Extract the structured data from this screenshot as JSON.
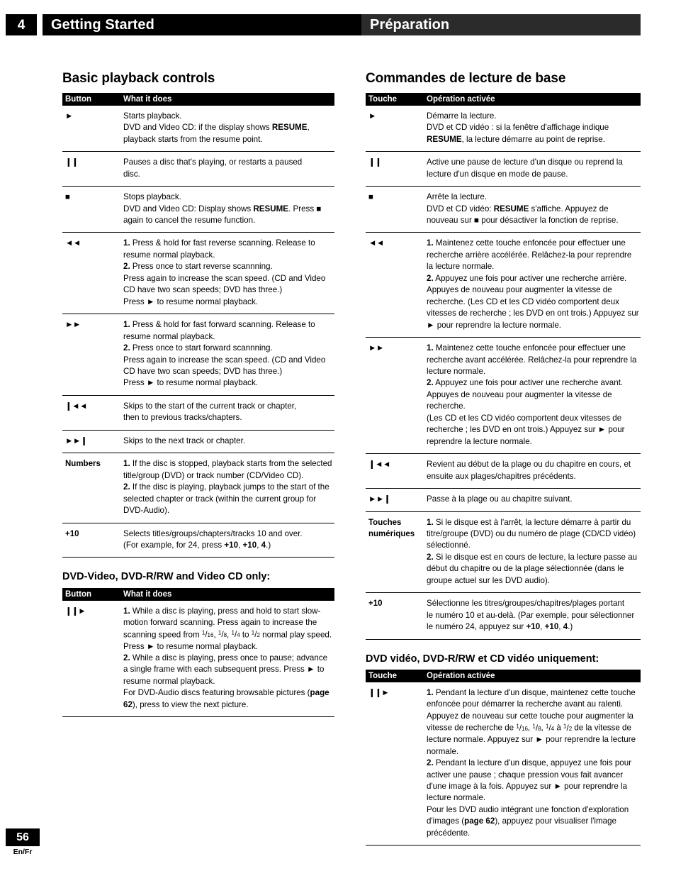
{
  "header": {
    "chapter_number": "4",
    "title_left": "Getting Started",
    "title_right": "Préparation"
  },
  "footer": {
    "page_number": "56",
    "language": "En/Fr"
  },
  "left_column": {
    "section_title": "Basic playback controls",
    "table": {
      "col1_header": "Button",
      "col2_header": "What it does",
      "rows": [
        {
          "button": "►",
          "line1": "Starts playback.",
          "line2_a": "DVD and Video CD: if the display shows ",
          "line2_b": "RESUME",
          "line2_c": ",",
          "line3": "playback starts from the resume point."
        },
        {
          "button": "❙❙",
          "line1": "Pauses a disc that's playing, or restarts a paused",
          "line2": "disc."
        },
        {
          "button": "■",
          "line1": "Stops playback.",
          "line2_a": "DVD and Video CD: Display shows ",
          "line2_b": "RESUME",
          "line2_c": ". Press ■",
          "line3": "again to cancel the resume function."
        },
        {
          "button": "◄◄",
          "item1_num": "1.",
          "item1_text": " Press & hold for fast reverse scanning. Release to resume normal playback.",
          "item2_num": "2.",
          "item2_text": " Press once to start reverse scannning.",
          "item3_text": "Press again to increase the scan speed. (CD and Video CD have two scan speeds; DVD has three.)",
          "item4_text": "Press ► to resume normal playback."
        },
        {
          "button": "►►",
          "item1_num": "1.",
          "item1_text": " Press & hold for fast forward scanning. Release to resume normal playback.",
          "item2_num": "2.",
          "item2_text": " Press once to start forward scannning.",
          "item3_text": "Press again to increase the scan speed. (CD and Video CD have two scan speeds; DVD has three.)",
          "item4_text": "Press ► to resume normal playback."
        },
        {
          "button": "❙◄◄",
          "line1": "Skips to the start of the current track or chapter,",
          "line2": "then to previous tracks/chapters."
        },
        {
          "button": "►►❙",
          "line1": "Skips to the next track or chapter."
        },
        {
          "button": "Numbers",
          "item1_num": "1.",
          "item1_text": " If the disc is stopped, playback starts from the selected title/group (DVD) or track number (CD/Video CD).",
          "item2_num": "2.",
          "item2_text": " If the disc is playing, playback jumps to the start of the selected chapter or track (within the current group for DVD-Audio)."
        },
        {
          "button": "+10",
          "line1": "Selects titles/groups/chapters/tracks 10 and over.",
          "line2_a": "(For example, for 24, press ",
          "line2_b": "+10",
          "line2_c": ", ",
          "line2_d": "+10",
          "line2_e": ", ",
          "line2_f": "4",
          "line2_g": ".)"
        }
      ]
    },
    "sub_section": {
      "title": "DVD-Video, DVD-R/RW and Video CD only:",
      "col1_header": "Button",
      "col2_header": "What it does",
      "row": {
        "button": "❙❙►",
        "item1_num": "1.",
        "item1_text_a": " While a disc is playing, press and hold to start slow-motion forward scanning. Press again to increase the scanning speed from ",
        "frac1_n": "1",
        "frac1_d": "16",
        "frac_sep1": ", ",
        "frac2_n": "1",
        "frac2_d": "8",
        "frac_sep2": ", ",
        "frac3_n": "1",
        "frac3_d": "4",
        "frac_sep3": " to ",
        "frac4_n": "1",
        "frac4_d": "2",
        "item1_text_b": " normal play speed. Press ► to resume normal playback.",
        "item2_num": "2.",
        "item2_text": " While a disc is playing, press once to pause; advance a single frame with each subsequent press. Press ► to resume normal playback.",
        "item3_text_a": "For DVD-Audio discs featuring browsable pictures (",
        "item3_bold": "page 62",
        "item3_text_b": "), press to view the next picture."
      }
    }
  },
  "right_column": {
    "section_title": "Commandes de lecture de base",
    "table": {
      "col1_header": "Touche",
      "col2_header": "Opération activée",
      "rows": [
        {
          "button": "►",
          "line1": "Démarre la lecture.",
          "line2": "DVD et CD vidéo : si la fenêtre d'affichage indique",
          "line3_a": "RESUME",
          "line3_b": ", la lecture démarre au point de reprise."
        },
        {
          "button": "❙❙",
          "line1": "Active une pause de lecture d'un disque ou reprend la",
          "line2": "lecture d'un disque en mode de pause."
        },
        {
          "button": "■",
          "line1": "Arrête la lecture.",
          "line2_a": "DVD et CD vidéo: ",
          "line2_b": "RESUME",
          "line2_c": " s'affiche. Appuyez de",
          "line3": "nouveau sur ■ pour désactiver la fonction de reprise."
        },
        {
          "button": "◄◄",
          "item1_num": "1.",
          "item1_text": " Maintenez cette touche enfoncée pour effectuer une recherche arrière accélérée. Relâchez-la pour reprendre la lecture normale.",
          "item2_num": "2.",
          "item2_text": " Appuyez une fois pour activer une recherche arrière. Appuyes de nouveau pour  augmenter la vitesse de recherche. (Les CD et les CD vidéo comportent deux vitesses de recherche ; les DVD en ont trois.) Appuyez sur ► pour reprendre la lecture normale."
        },
        {
          "button": "►►",
          "item1_num": "1.",
          "item1_text": " Maintenez cette touche enfoncée pour effectuer une recherche avant accélérée. Relâchez-la pour reprendre la lecture normale.",
          "item2_num": "2.",
          "item2_text": " Appuyez une fois pour activer une recherche avant. Appuyes de nouveau pour  augmenter la vitesse de recherche.",
          "item3_text": " (Les CD et les CD vidéo comportent deux vitesses de recherche ; les DVD en ont trois.) Appuyez sur ► pour reprendre la lecture normale."
        },
        {
          "button": "❙◄◄",
          "line1": "Revient au début de la plage ou du chapitre en cours, et",
          "line2": "ensuite aux plages/chapitres précédents."
        },
        {
          "button": "►►❙",
          "line1": "Passe à la plage ou au chapitre suivant."
        },
        {
          "button_line1": "Touches",
          "button_line2": "numériques",
          "item1_num": "1.",
          "item1_text": " Si le disque est à l'arrêt, la lecture démarre à partir du titre/groupe (DVD) ou du numéro de plage (CD/CD vidéo) sélectionné.",
          "item2_num": "2.",
          "item2_text": " Si le disque est en cours de lecture, la lecture passe au début du chapitre ou de la plage sélectionnée (dans le groupe actuel sur les DVD audio)."
        },
        {
          "button": "+10",
          "line1": "Sélectionne les titres/groupes/chapitres/plages portant",
          "line2": "le numéro 10 et au-delà. (Par exemple, pour sélectionner",
          "line3_a": "le numéro 24, appuyez sur ",
          "line3_b": "+10",
          "line3_c": ", ",
          "line3_d": "+10",
          "line3_e": ", ",
          "line3_f": "4",
          "line3_g": ".)"
        }
      ]
    },
    "sub_section": {
      "title": "DVD vidéo, DVD-R/RW et CD vidéo uniquement:",
      "col1_header": "Touche",
      "col2_header": "Opération activée",
      "row": {
        "button": "❙❙►",
        "item1_num": "1.",
        "item1_text_a": " Pendant la lecture d'un disque, maintenez cette touche enfoncée pour démarrer la recherche avant au ralenti. Appuyez de nouveau sur cette touche pour augmenter la vitesse de recherche de ",
        "frac1_n": "1",
        "frac1_d": "16",
        "frac_sep1": ", ",
        "frac2_n": "1",
        "frac2_d": "8",
        "frac_sep2": ", ",
        "frac3_n": "1",
        "frac3_d": "4",
        "frac_sep3": " à ",
        "frac4_n": "1",
        "frac4_d": "2",
        "item1_text_b": " de la vitesse de lecture normale. Appuyez sur ► pour reprendre la lecture normale.",
        "item2_num": "2.",
        "item2_text": " Pendant la lecture d'un disque, appuyez une fois pour activer une pause ; chaque pression vous fait avancer d'une image à la fois. Appuyez sur ► pour reprendre la lecture normale.",
        "item3_text_a": "Pour les DVD audio intégrant une fonction d'exploration d'images (",
        "item3_bold": "page 62",
        "item3_text_b": "), appuyez pour visualiser l'image précédente."
      }
    }
  }
}
